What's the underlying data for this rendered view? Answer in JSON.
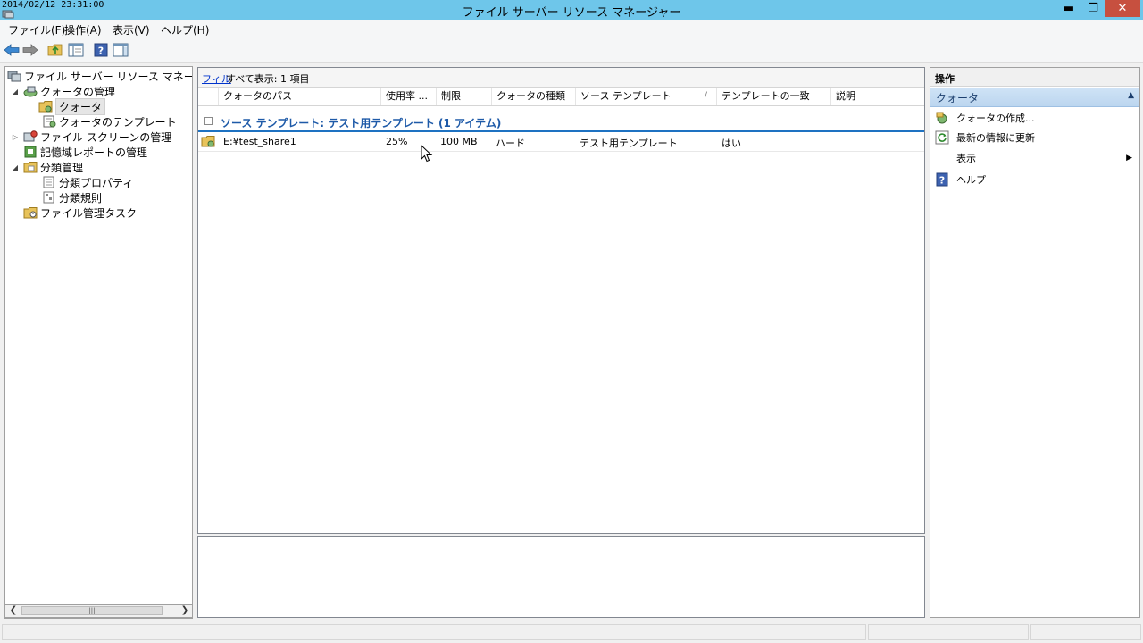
{
  "titlebar": {
    "timestamp": "2014/02/12 23:31:00",
    "title": "ファイル サーバー リソース マネージャー",
    "minimize": "▬",
    "maximize": "❐",
    "close": "✕"
  },
  "menu": {
    "file": "ファイル(F)",
    "action": "操作(A)",
    "view": "表示(V)",
    "help": "ヘルプ(H)"
  },
  "toolbar": {
    "icons": [
      "back-icon",
      "forward-icon",
      "up-folder-icon",
      "show-hide-tree-icon",
      "help-icon",
      "show-hide-action-pane-icon"
    ]
  },
  "tree": {
    "root": "ファイル サーバー リソース マネージャー (ロー",
    "quota_management": "クォータの管理",
    "quotas": "クォータ",
    "quota_templates": "クォータのテンプレート",
    "file_screen_management": "ファイル スクリーンの管理",
    "storage_reports": "記憶域レポートの管理",
    "classification_management": "分類管理",
    "classification_properties": "分類プロパティ",
    "classification_rules": "分類規則",
    "file_management_tasks": "ファイル管理タスク"
  },
  "list": {
    "filter_link": "フィル",
    "filter_summary": "すべて表示: 1 項目",
    "columns": {
      "path": "クォータのパス",
      "usage": "使用率 ...",
      "limit": "制限",
      "type": "クォータの種類",
      "source_template": "ソース テンプレート",
      "sort_indicator": "/",
      "matches_template": "テンプレートの一致",
      "description": "説明"
    },
    "group": {
      "toggle": "−",
      "label": "ソース テンプレート: テスト用テンプレート (1 アイテム)"
    },
    "rows": [
      {
        "path": "E:¥test_share1",
        "usage": "25%",
        "limit": "100 MB",
        "type": "ハード",
        "source_template": "テスト用テンプレート",
        "matches_template": "はい",
        "description": ""
      }
    ]
  },
  "actions": {
    "title": "操作",
    "section": "クォータ",
    "create_quota": "クォータの作成...",
    "refresh": "最新の情報に更新",
    "view": "表示",
    "help": "ヘルプ"
  },
  "colors": {
    "titlebar": "#6ec6ea",
    "close_button": "#c7503f",
    "group_label": "#1e5aa8",
    "group_underline": "#1e72c2",
    "actions_section": "#bcd6ef"
  }
}
